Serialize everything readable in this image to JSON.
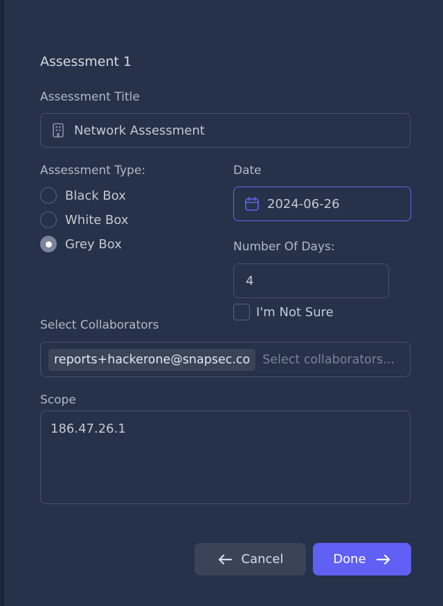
{
  "form": {
    "heading": "Assessment 1",
    "title_label": "Assessment Title",
    "title_value": "Network Assessment",
    "title_icon": "building-icon",
    "type_label": "Assessment Type:",
    "types": [
      {
        "label": "Black Box",
        "checked": false
      },
      {
        "label": "White Box",
        "checked": false
      },
      {
        "label": "Grey Box",
        "checked": true
      }
    ],
    "date_label": "Date",
    "date_value": "2024-06-26",
    "date_icon": "calendar-icon",
    "days_label": "Number Of Days:",
    "days_value": "4",
    "not_sure_label": "I'm Not Sure",
    "not_sure_checked": false,
    "collaborators_label": "Select Collaborators",
    "collaborator_chip": "reports+hackerone@snapsec.co",
    "collaborators_placeholder": "Select collaborators...",
    "scope_label": "Scope",
    "scope_value": "186.47.26.1"
  },
  "actions": {
    "cancel_label": "Cancel",
    "done_label": "Done"
  },
  "colors": {
    "background": "#263249",
    "accent": "#6160f4",
    "date_border": "#6366f1"
  }
}
